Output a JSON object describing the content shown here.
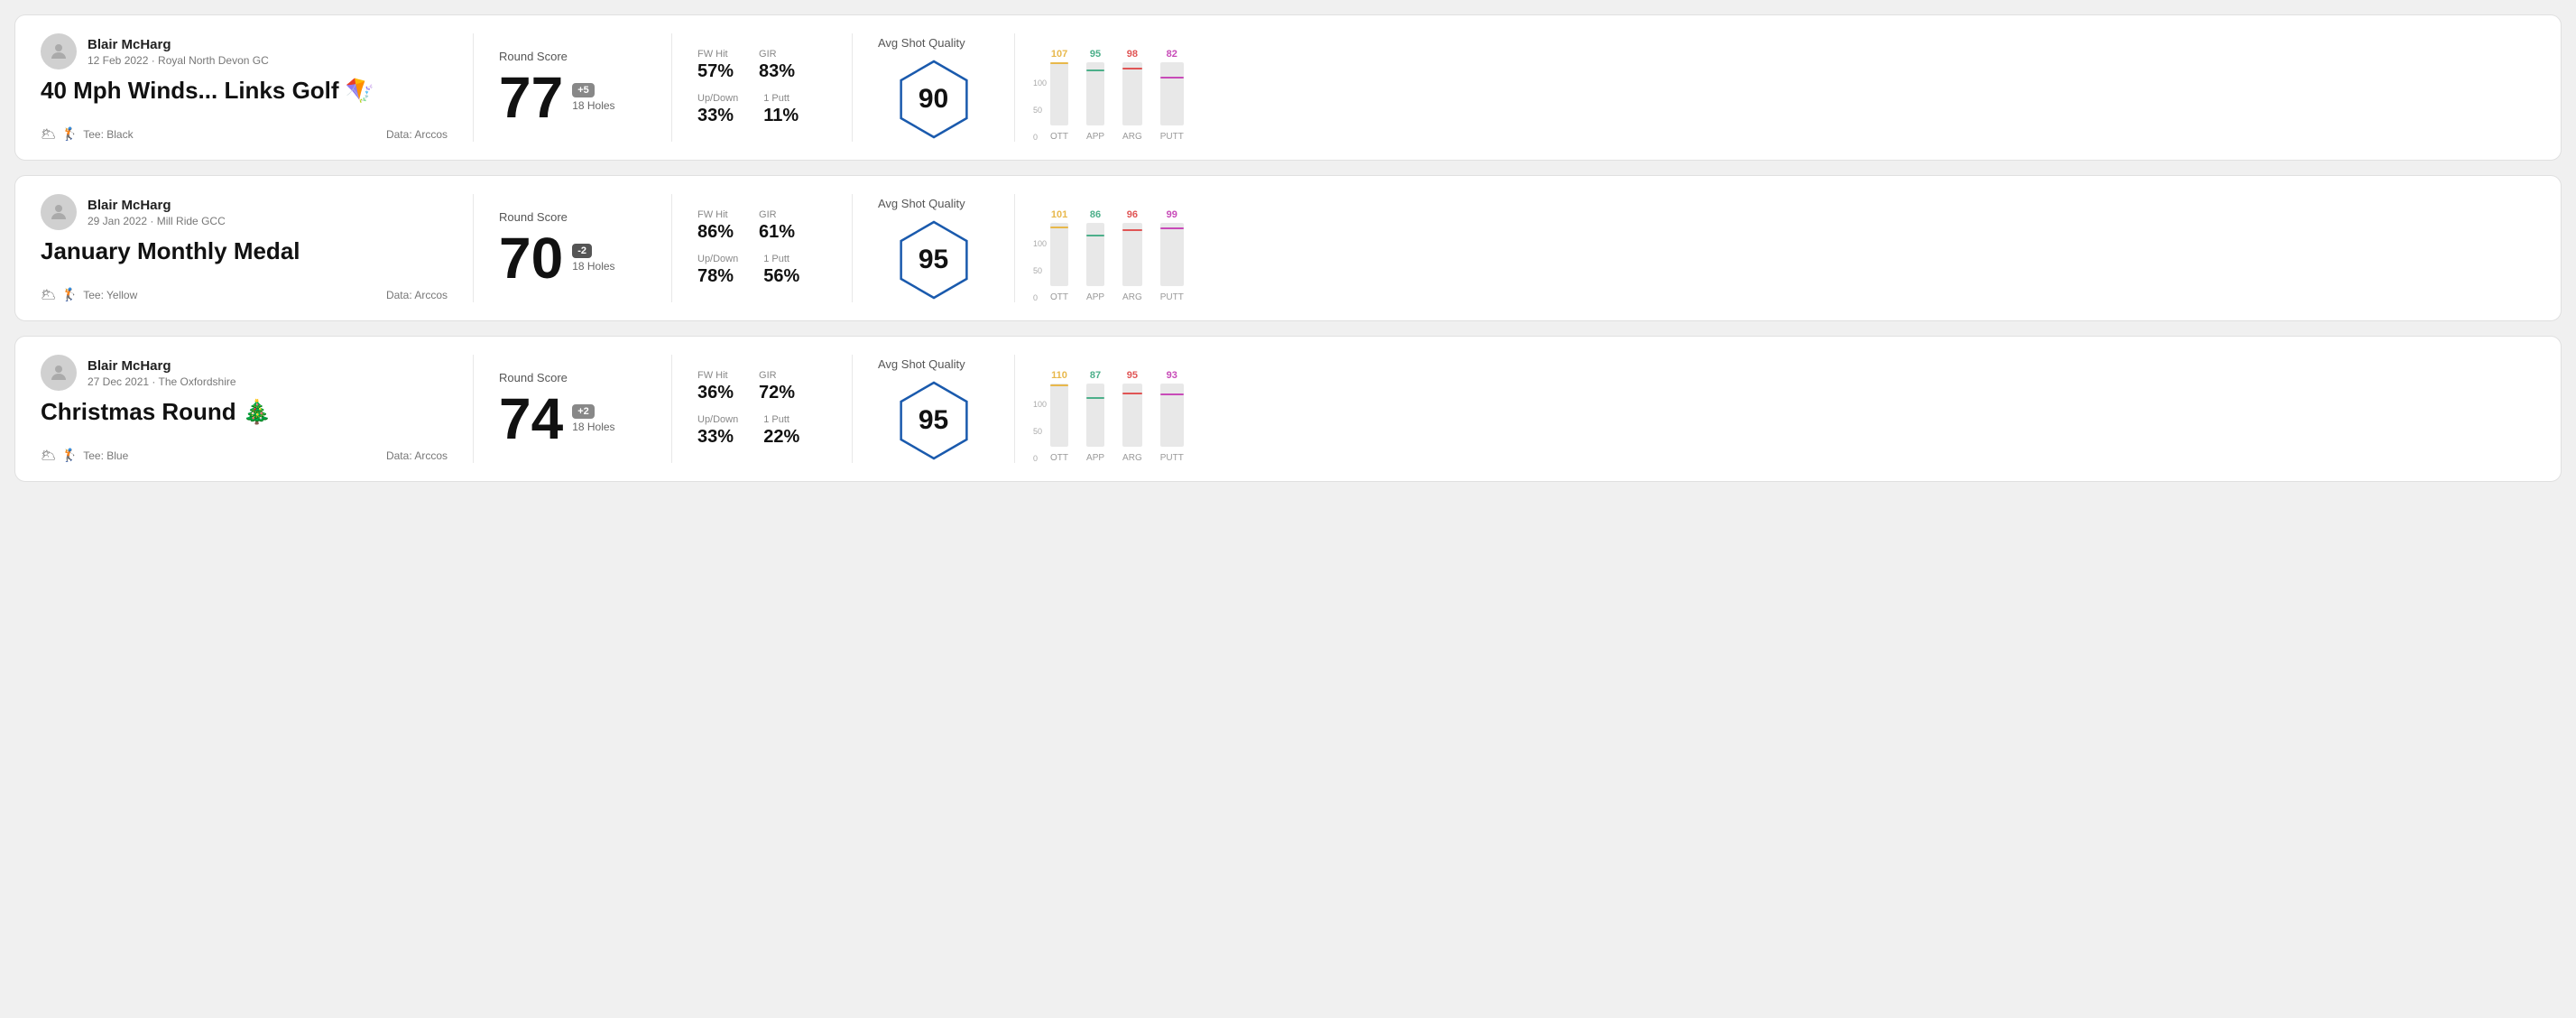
{
  "rounds": [
    {
      "id": "round1",
      "user": {
        "name": "Blair McHarg",
        "date": "12 Feb 2022",
        "course": "Royal North Devon GC"
      },
      "title": "40 Mph Winds... Links Golf 🪁",
      "tee": "Black",
      "data_source": "Arccos",
      "round_score_label": "Round Score",
      "score": "77",
      "score_diff": "+5",
      "holes": "18 Holes",
      "fw_hit_label": "FW Hit",
      "fw_hit": "57%",
      "gir_label": "GIR",
      "gir": "83%",
      "updown_label": "Up/Down",
      "updown": "33%",
      "oneputt_label": "1 Putt",
      "oneputt": "11%",
      "avg_shot_quality_label": "Avg Shot Quality",
      "quality_score": "90",
      "chart": {
        "bars": [
          {
            "label": "OTT",
            "value": 107,
            "color": "#e8b84b"
          },
          {
            "label": "APP",
            "value": 95,
            "color": "#4caf8a"
          },
          {
            "label": "ARG",
            "value": 98,
            "color": "#e05555"
          },
          {
            "label": "PUTT",
            "value": 82,
            "color": "#c84bb8"
          }
        ],
        "max": 110,
        "y_labels": [
          "100",
          "50",
          "0"
        ]
      }
    },
    {
      "id": "round2",
      "user": {
        "name": "Blair McHarg",
        "date": "29 Jan 2022",
        "course": "Mill Ride GCC"
      },
      "title": "January Monthly Medal",
      "tee": "Yellow",
      "data_source": "Arccos",
      "round_score_label": "Round Score",
      "score": "70",
      "score_diff": "-2",
      "holes": "18 Holes",
      "fw_hit_label": "FW Hit",
      "fw_hit": "86%",
      "gir_label": "GIR",
      "gir": "61%",
      "updown_label": "Up/Down",
      "updown": "78%",
      "oneputt_label": "1 Putt",
      "oneputt": "56%",
      "avg_shot_quality_label": "Avg Shot Quality",
      "quality_score": "95",
      "chart": {
        "bars": [
          {
            "label": "OTT",
            "value": 101,
            "color": "#e8b84b"
          },
          {
            "label": "APP",
            "value": 86,
            "color": "#4caf8a"
          },
          {
            "label": "ARG",
            "value": 96,
            "color": "#e05555"
          },
          {
            "label": "PUTT",
            "value": 99,
            "color": "#c84bb8"
          }
        ],
        "max": 110,
        "y_labels": [
          "100",
          "50",
          "0"
        ]
      }
    },
    {
      "id": "round3",
      "user": {
        "name": "Blair McHarg",
        "date": "27 Dec 2021",
        "course": "The Oxfordshire"
      },
      "title": "Christmas Round 🎄",
      "tee": "Blue",
      "data_source": "Arccos",
      "round_score_label": "Round Score",
      "score": "74",
      "score_diff": "+2",
      "holes": "18 Holes",
      "fw_hit_label": "FW Hit",
      "fw_hit": "36%",
      "gir_label": "GIR",
      "gir": "72%",
      "updown_label": "Up/Down",
      "updown": "33%",
      "oneputt_label": "1 Putt",
      "oneputt": "22%",
      "avg_shot_quality_label": "Avg Shot Quality",
      "quality_score": "95",
      "chart": {
        "bars": [
          {
            "label": "OTT",
            "value": 110,
            "color": "#e8b84b"
          },
          {
            "label": "APP",
            "value": 87,
            "color": "#4caf8a"
          },
          {
            "label": "ARG",
            "value": 95,
            "color": "#e05555"
          },
          {
            "label": "PUTT",
            "value": 93,
            "color": "#c84bb8"
          }
        ],
        "max": 115,
        "y_labels": [
          "100",
          "50",
          "0"
        ]
      }
    }
  ]
}
